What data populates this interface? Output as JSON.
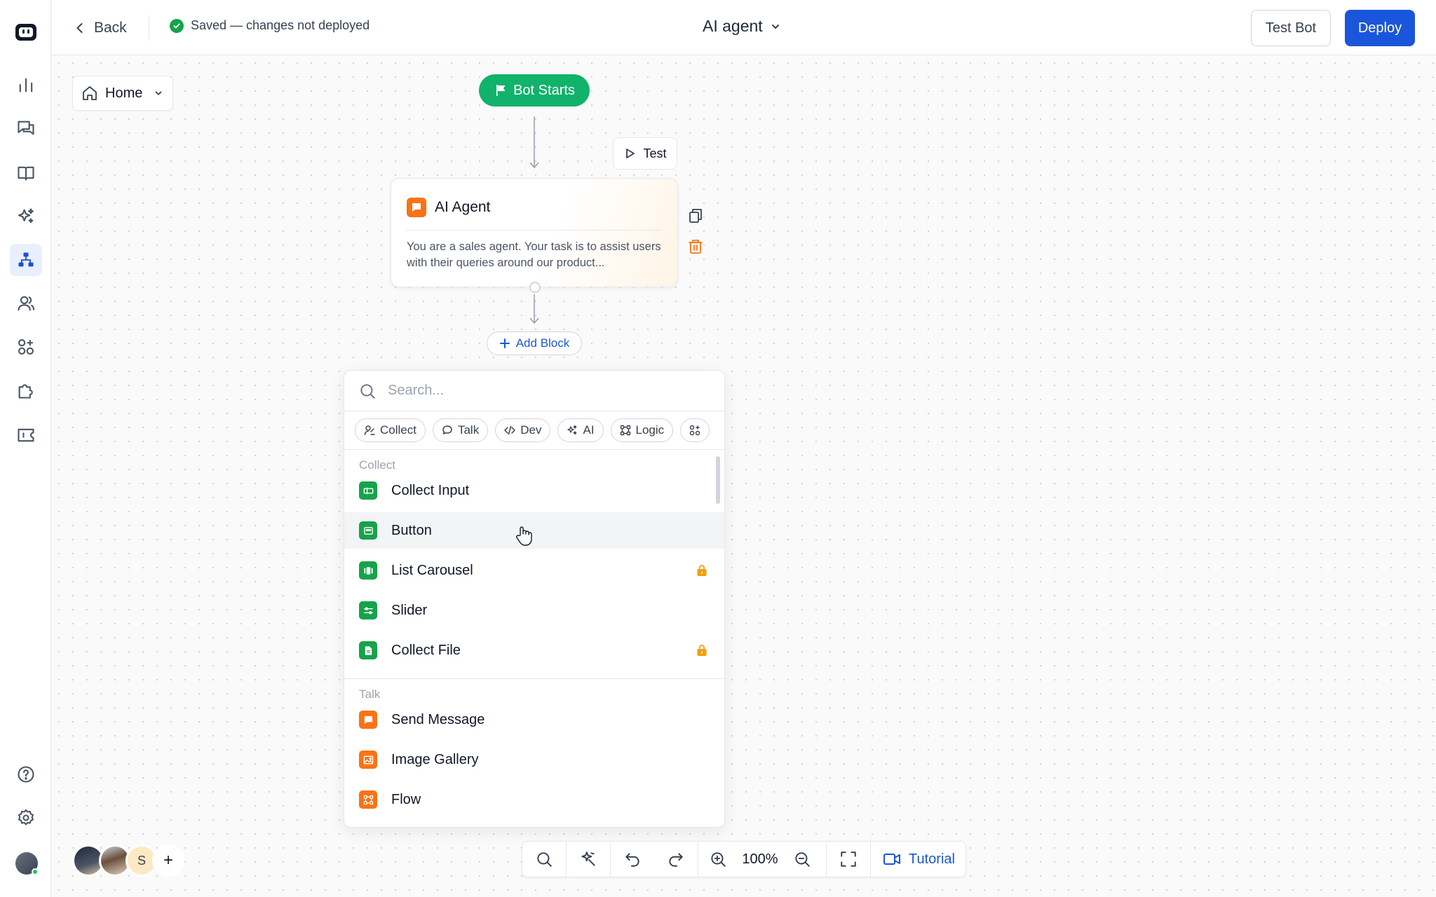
{
  "topbar": {
    "back_label": "Back",
    "status": "Saved — changes not deployed",
    "bot_name": "AI agent",
    "test_bot_label": "Test Bot",
    "deploy_label": "Deploy"
  },
  "canvas": {
    "page_selector": "Home",
    "start_node": "Bot Starts",
    "test_chip": "Test",
    "agent_card": {
      "title": "AI Agent",
      "description": "You are a sales agent. Your task is to assist users with their queries around our product..."
    },
    "add_block_label": "Add Block"
  },
  "picker": {
    "search_placeholder": "Search...",
    "filters": [
      "Collect",
      "Talk",
      "Dev",
      "AI",
      "Logic"
    ],
    "sections": [
      {
        "label": "Collect",
        "items": [
          {
            "label": "Collect Input",
            "locked": false
          },
          {
            "label": "Button",
            "locked": false
          },
          {
            "label": "List Carousel",
            "locked": true
          },
          {
            "label": "Slider",
            "locked": false
          },
          {
            "label": "Collect File",
            "locked": true
          }
        ]
      },
      {
        "label": "Talk",
        "items": [
          {
            "label": "Send Message",
            "locked": false
          },
          {
            "label": "Image Gallery",
            "locked": false
          },
          {
            "label": "Flow",
            "locked": false
          }
        ]
      }
    ]
  },
  "collaborators": {
    "initial": "S",
    "add_label": "+"
  },
  "toolbar": {
    "zoom": "100%",
    "tutorial_label": "Tutorial"
  },
  "colors": {
    "primary": "#1a56db",
    "start_green": "#10b26c",
    "block_green": "#16a34a",
    "block_orange": "#f97316",
    "lock": "#f59e0b"
  }
}
